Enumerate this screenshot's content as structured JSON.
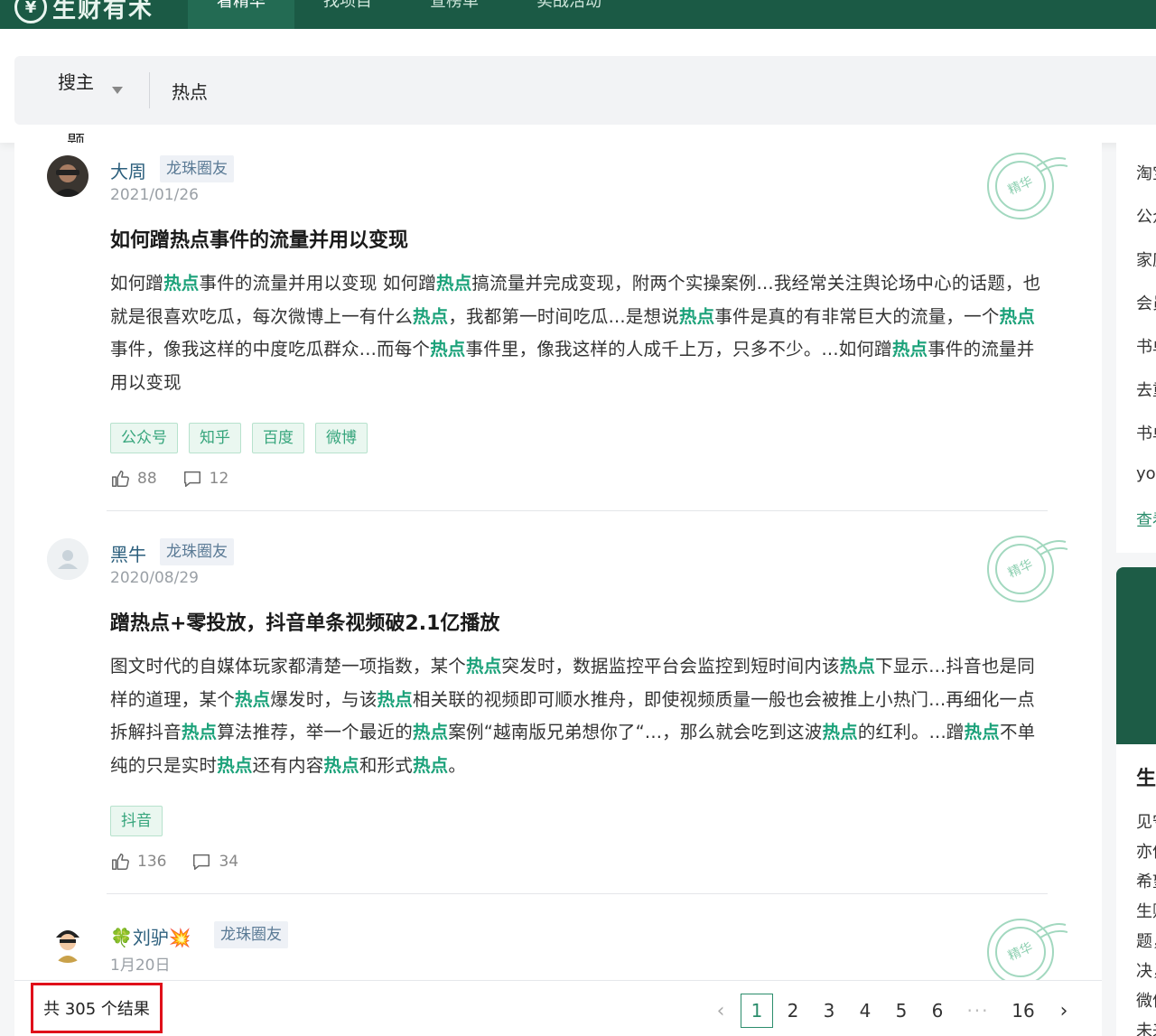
{
  "header": {
    "logo_text": "生财有术",
    "nav": [
      {
        "label": "看精华",
        "active": true
      },
      {
        "label": "找项目",
        "active": false
      },
      {
        "label": "查榜单",
        "active": false
      },
      {
        "label": "实战活动",
        "active": false
      }
    ]
  },
  "search": {
    "scope_label": "搜主题",
    "query": "热点"
  },
  "posts": [
    {
      "author": "大周",
      "badge": "龙珠圈友",
      "date": "2021/01/26",
      "title": "如何蹭热点事件的流量并用以变现",
      "excerpt_parts": [
        {
          "t": "如何蹭"
        },
        {
          "t": "热点",
          "hl": true
        },
        {
          "t": "事件的流量并用以变现 如何蹭"
        },
        {
          "t": "热点",
          "hl": true
        },
        {
          "t": "搞流量并完成变现，附两个实操案例...我经常关注舆论场中心的话题，也就是很喜欢吃瓜，每次微博上一有什么"
        },
        {
          "t": "热点",
          "hl": true
        },
        {
          "t": "，我都第一时间吃瓜...是想说"
        },
        {
          "t": "热点",
          "hl": true
        },
        {
          "t": "事件是真的有非常巨大的流量，一个"
        },
        {
          "t": "热点",
          "hl": true
        },
        {
          "t": "事件，像我这样的中度吃瓜群众...而每个"
        },
        {
          "t": "热点",
          "hl": true
        },
        {
          "t": "事件里，像我这样的人成千上万，只多不少。...如何蹭"
        },
        {
          "t": "热点",
          "hl": true
        },
        {
          "t": "事件的流量并用以变现"
        }
      ],
      "tags": [
        "公众号",
        "知乎",
        "百度",
        "微博"
      ],
      "likes": "88",
      "comments": "12",
      "stamp_label": "精华"
    },
    {
      "author": "黑牛",
      "badge": "龙珠圈友",
      "date": "2020/08/29",
      "title": "蹭热点+零投放，抖音单条视频破2.1亿播放",
      "excerpt_parts": [
        {
          "t": "图文时代的自媒体玩家都清楚一项指数，某个"
        },
        {
          "t": "热点",
          "hl": true
        },
        {
          "t": "突发时，数据监控平台会监控到短时间内该"
        },
        {
          "t": "热点",
          "hl": true
        },
        {
          "t": "下显示...抖音也是同样的道理，某个"
        },
        {
          "t": "热点",
          "hl": true
        },
        {
          "t": "爆发时，与该"
        },
        {
          "t": "热点",
          "hl": true
        },
        {
          "t": "相关联的视频即可顺水推舟，即使视频质量一般也会被推上小热门...再细化一点拆解抖音"
        },
        {
          "t": "热点",
          "hl": true
        },
        {
          "t": "算法推荐，举一个最近的"
        },
        {
          "t": "热点",
          "hl": true
        },
        {
          "t": "案例“越南版兄弟想你了“...，那么就会吃到这波"
        },
        {
          "t": "热点",
          "hl": true
        },
        {
          "t": "的红利。...蹭"
        },
        {
          "t": "热点",
          "hl": true
        },
        {
          "t": "不单纯的只是实时"
        },
        {
          "t": "热点",
          "hl": true
        },
        {
          "t": "还有内容"
        },
        {
          "t": "热点",
          "hl": true
        },
        {
          "t": "和形式"
        },
        {
          "t": "热点",
          "hl": true
        },
        {
          "t": "。"
        }
      ],
      "tags": [
        "抖音"
      ],
      "likes": "136",
      "comments": "34",
      "stamp_label": "精华"
    },
    {
      "author": "🍀刘驴💥",
      "badge": "龙珠圈友",
      "date": "1月20日",
      "stamp_label": "精华"
    }
  ],
  "footer": {
    "result_count": "共 305 个结果",
    "pages": [
      "1",
      "2",
      "3",
      "4",
      "5",
      "6"
    ],
    "ellipsis": "···",
    "last_page": "16",
    "current_page": "1"
  },
  "sidebar": {
    "list_items": [
      "淘宝",
      "公众",
      "家庭",
      "会员",
      "书单",
      "去重",
      "书单",
      "yo"
    ],
    "more_link": "查看",
    "section_title": "生",
    "section_lines": [
      "见守",
      "亦仲",
      "希望",
      "生财",
      "题，",
      "决，",
      "微信",
      "未来"
    ]
  },
  "colors": {
    "brand_green": "#1b5a45",
    "highlight": "#1ca27a",
    "annotation_red": "#e0101a"
  }
}
